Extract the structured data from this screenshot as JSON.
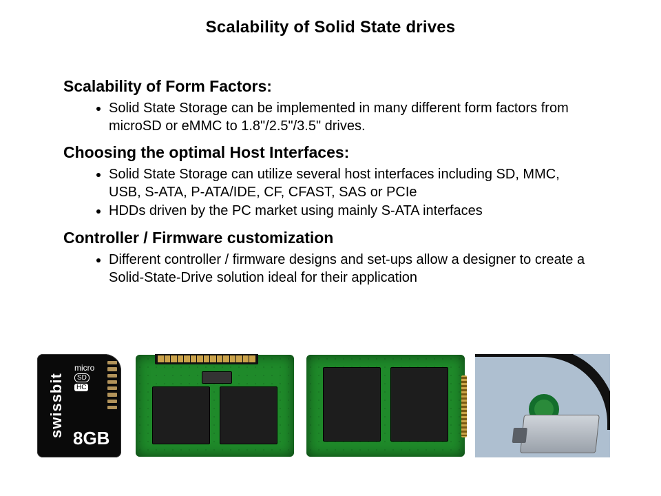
{
  "title": "Scalability of Solid State drives",
  "sections": [
    {
      "heading": "Scalability of Form Factors:",
      "bullets": [
        "Solid State Storage can be implemented in many different form factors from microSD or eMMC to 1.8\"/2.5\"/3.5\" drives."
      ]
    },
    {
      "heading": "Choosing the optimal Host Interfaces:",
      "bullets": [
        "Solid State Storage can utilize several host interfaces including SD, MMC, USB, S-ATA, P-ATA/IDE,  CF, CFAST, SAS or PCIe",
        "HDDs driven by the PC market using mainly S-ATA interfaces"
      ]
    },
    {
      "heading": "Controller / Firmware customization",
      "bullets": [
        "Different controller / firmware designs and set-ups allow a designer to create a Solid-State-Drive solution ideal for their application"
      ]
    }
  ],
  "microsd": {
    "brand": "swissbit",
    "logo_line1": "micro",
    "logo_pill": "SD",
    "logo_hc": "HC",
    "capacity": "8GB"
  },
  "images": [
    {
      "name": "microsd-card",
      "alt": "swissbit 8GB microSDHC card"
    },
    {
      "name": "sata-ssd-module",
      "alt": "Green PCB SSD module with SATA connector"
    },
    {
      "name": "msata-ssd-module",
      "alt": "Green mSATA SSD module"
    },
    {
      "name": "sas-cable-connector",
      "alt": "SAS cable with metal connector and green pull loop"
    }
  ]
}
